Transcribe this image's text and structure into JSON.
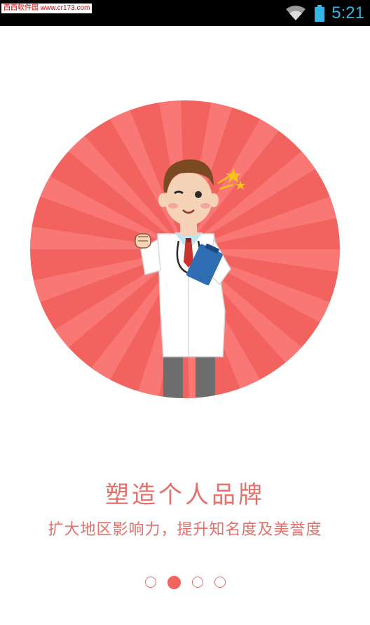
{
  "status_bar": {
    "watermark": "西西软件园 www.cr173.com",
    "time": "5:21",
    "icons": [
      "wifi-icon",
      "battery-icon"
    ]
  },
  "onboarding": {
    "title": "塑造个人品牌",
    "subtitle": "扩大地区影响力，提升知名度及美誉度",
    "page_indicator": {
      "total": 4,
      "current": 2
    }
  },
  "colors": {
    "accent": "#e4706c",
    "circle": "#f2635f",
    "status_bar": "#000000",
    "clock": "#33b5e5"
  }
}
